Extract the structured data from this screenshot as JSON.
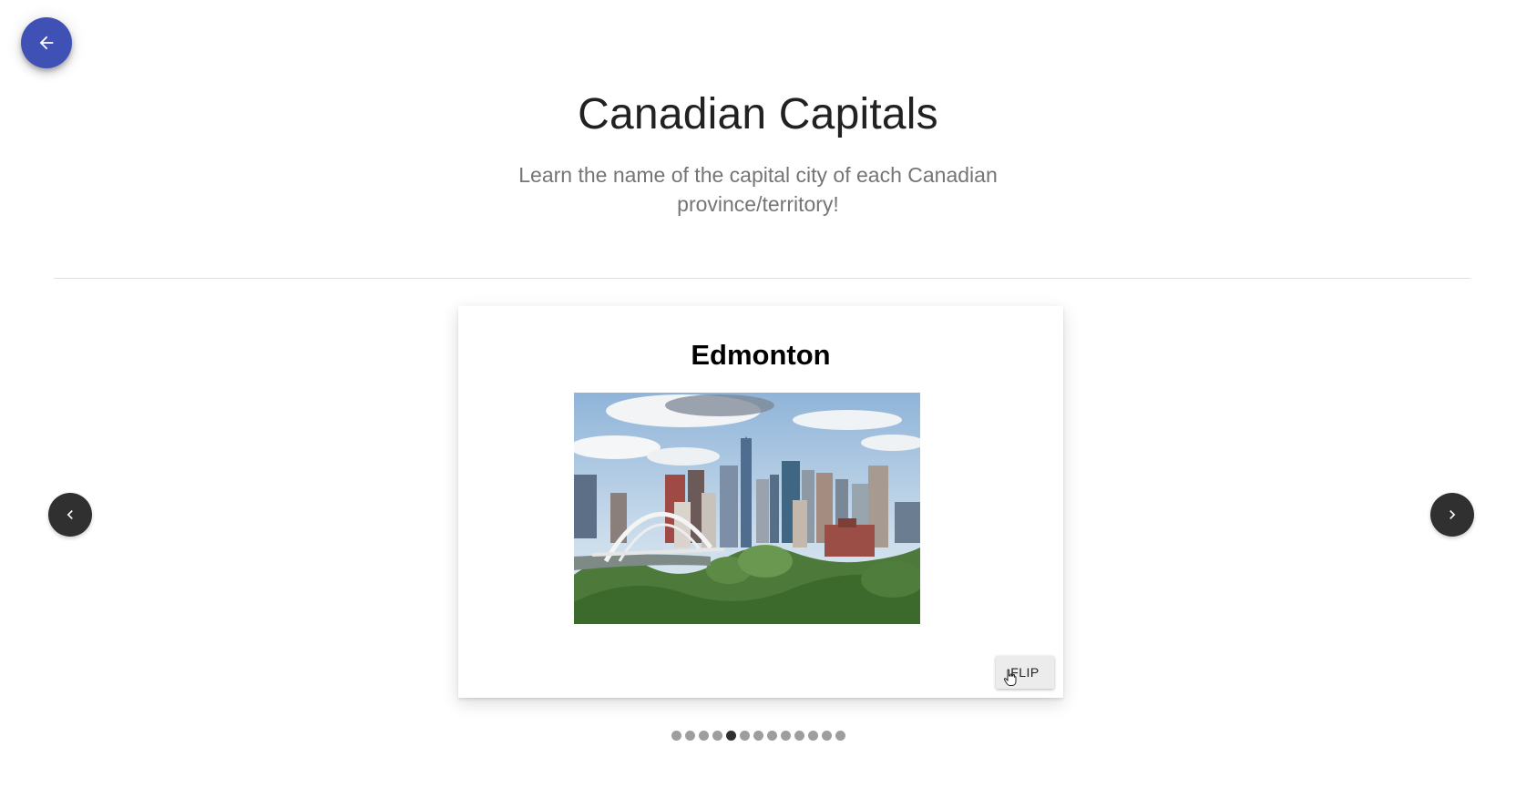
{
  "header": {
    "title": "Canadian Capitals",
    "subtitle": "Learn the name of the capital city of each Canadian province/territory!"
  },
  "icons": {
    "back": "arrow-left-icon",
    "prev": "chevron-left-icon",
    "next": "chevron-right-icon",
    "cursor": "hand-pointer-icon"
  },
  "colors": {
    "back_button": "#3f51b5",
    "nav_button": "#303030",
    "dot_inactive": "#9e9e9e",
    "dot_active": "#303030"
  },
  "card": {
    "title": "Edmonton",
    "image_alt": "Edmonton skyline",
    "flip_label": "FLIP"
  },
  "pagination": {
    "total": 13,
    "current": 5
  }
}
